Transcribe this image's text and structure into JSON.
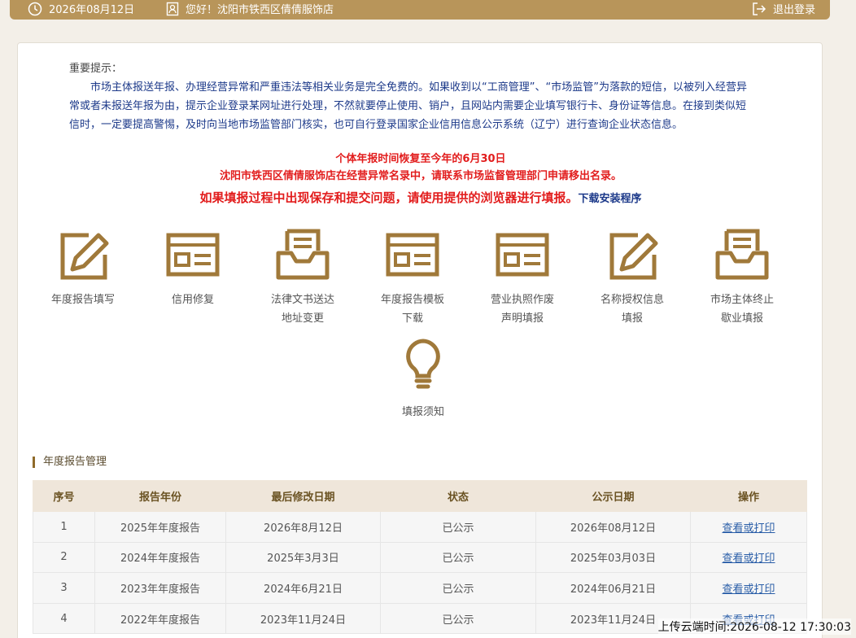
{
  "header": {
    "date": "2026年08月12日",
    "greeting": "您好！沈阳市铁西区倩倩服饰店",
    "logout": "退出登录"
  },
  "notice": {
    "title": "重要提示：",
    "body": "市场主体报送年报、办理经营异常和严重违法等相关业务是完全免费的。如果收到以“工商管理”、“市场监管”为落款的短信，以被列入经营异常或者未报送年报为由，提示企业登录某网址进行处理，不然就要停止使用、销户，且网站内需要企业填写银行卡、身份证等信息。在接到类似短信时，一定要提高警惕，及时向当地市场监管部门核实，也可自行登录国家企业信用信息公示系统（辽宁）进行查询企业状态信息。"
  },
  "alerts": {
    "deadline": "个体年报时间恢复至今年的6月30日",
    "abnormal": "沈阳市铁西区倩倩服饰店在经营异常名录中，请联系市场监督管理部门申请移出名录。",
    "browser": "如果填报过程中出现保存和提交问题，请使用提供的浏览器进行填报。",
    "download": "下载安装程序"
  },
  "services": [
    {
      "line1": "年度报告填写",
      "line2": "",
      "icon": "edit-icon"
    },
    {
      "line1": "信用修复",
      "line2": "",
      "icon": "form-icon"
    },
    {
      "line1": "法律文书送达",
      "line2": "地址变更",
      "icon": "inbox-icon"
    },
    {
      "line1": "年度报告模板",
      "line2": "下载",
      "icon": "form-icon"
    },
    {
      "line1": "营业执照作废",
      "line2": "声明填报",
      "icon": "form-icon"
    },
    {
      "line1": "名称授权信息",
      "line2": "填报",
      "icon": "edit-icon"
    },
    {
      "line1": "市场主体终止",
      "line2": "歇业填报",
      "icon": "inbox-icon"
    },
    {
      "line1": "填报须知",
      "line2": "",
      "icon": "lightbulb-icon"
    }
  ],
  "section": {
    "title": "年度报告管理"
  },
  "table": {
    "headers": [
      "序号",
      "报告年份",
      "最后修改日期",
      "状态",
      "公示日期",
      "操作"
    ],
    "rows": [
      {
        "no": "1",
        "year": "2025年年度报告",
        "modified": "2026年8月12日",
        "status": "已公示",
        "published": "2026年08月12日",
        "action": "查看或打印"
      },
      {
        "no": "2",
        "year": "2024年年度报告",
        "modified": "2025年3月3日",
        "status": "已公示",
        "published": "2025年03月03日",
        "action": "查看或打印"
      },
      {
        "no": "3",
        "year": "2023年年度报告",
        "modified": "2024年6月21日",
        "status": "已公示",
        "published": "2024年06月21日",
        "action": "查看或打印"
      },
      {
        "no": "4",
        "year": "2022年年度报告",
        "modified": "2023年11月24日",
        "status": "已公示",
        "published": "2023年11月24日",
        "action": "查看或打印"
      }
    ]
  },
  "footer": {
    "upload_time": "上传云端时间:2026-08-12 17:30:03"
  },
  "colors": {
    "accent": "#b8955a",
    "icon": "#a0793a",
    "alert": "#e21d1d",
    "link": "#1d3a8a"
  }
}
